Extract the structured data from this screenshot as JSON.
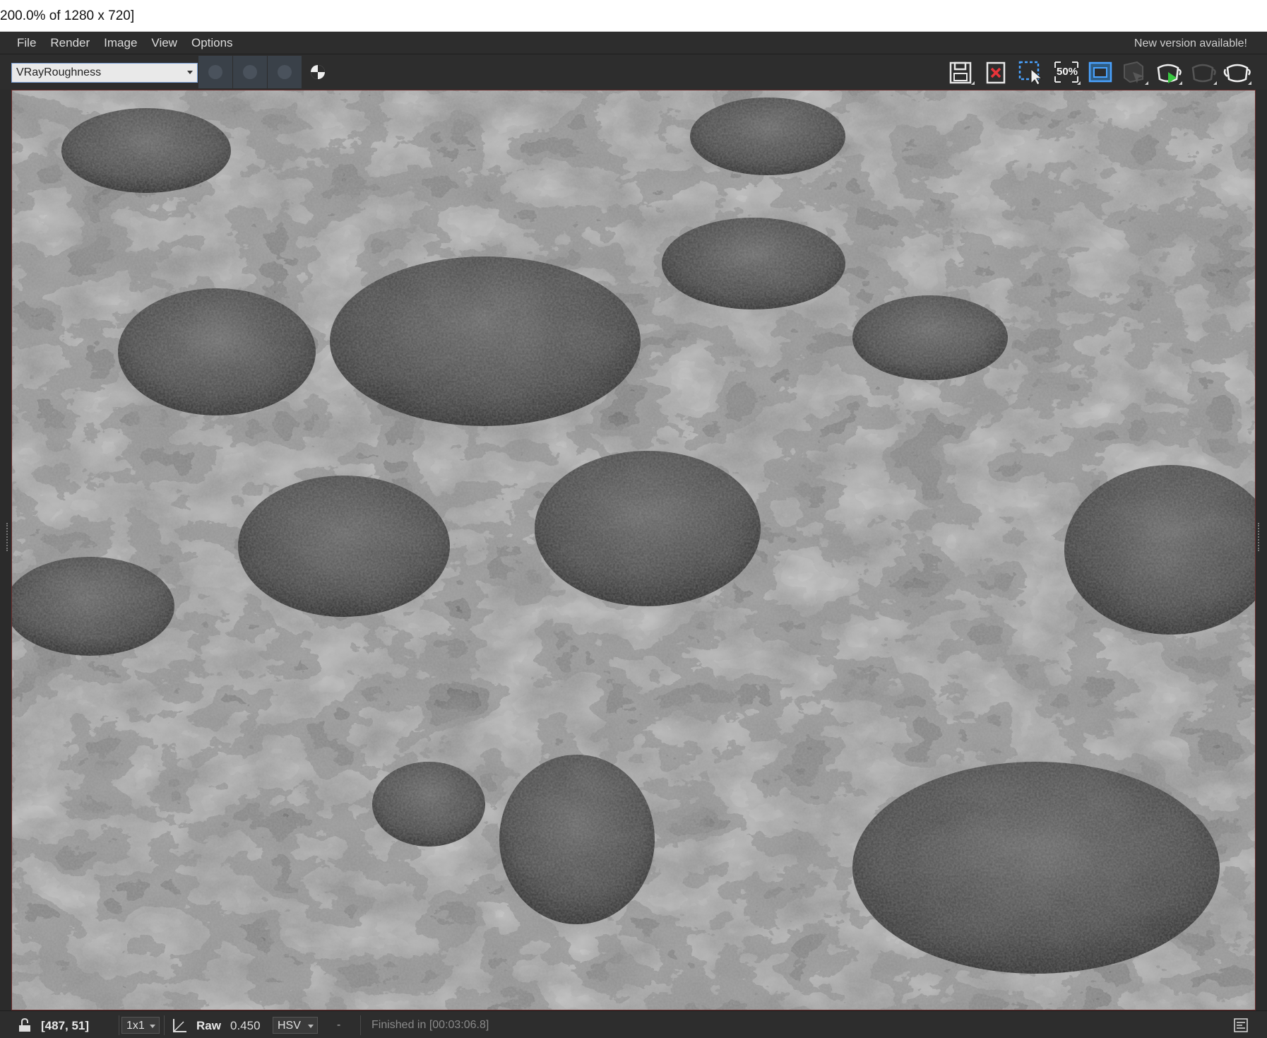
{
  "window": {
    "title": "200.0% of 1280 x 720]"
  },
  "menu": {
    "items": [
      "File",
      "Render",
      "Image",
      "View",
      "Options"
    ],
    "notice": "New version available!"
  },
  "toolbar": {
    "channel": "VRayRoughness",
    "zoom_label": "50%",
    "icons": [
      "save-icon",
      "clear-image-icon",
      "region-render-icon",
      "zoom-50-icon",
      "track-mouse-icon",
      "stop-render-icon",
      "interactive-render-icon",
      "render-last-disabled-icon",
      "render-icon"
    ]
  },
  "viewport": {
    "image": "VRayRoughness render element (grayscale terrain)"
  },
  "statusbar": {
    "coords": "[487, 51]",
    "sample": "1x1",
    "mode": "Raw",
    "value": "0.450",
    "color_space": "HSV",
    "dash": "-",
    "status": "Finished in [00:03:06.8]"
  },
  "colors": {
    "accent_blue": "#4aa3ff",
    "render_green": "#38c840",
    "frame_border": "#6a2b2b"
  }
}
